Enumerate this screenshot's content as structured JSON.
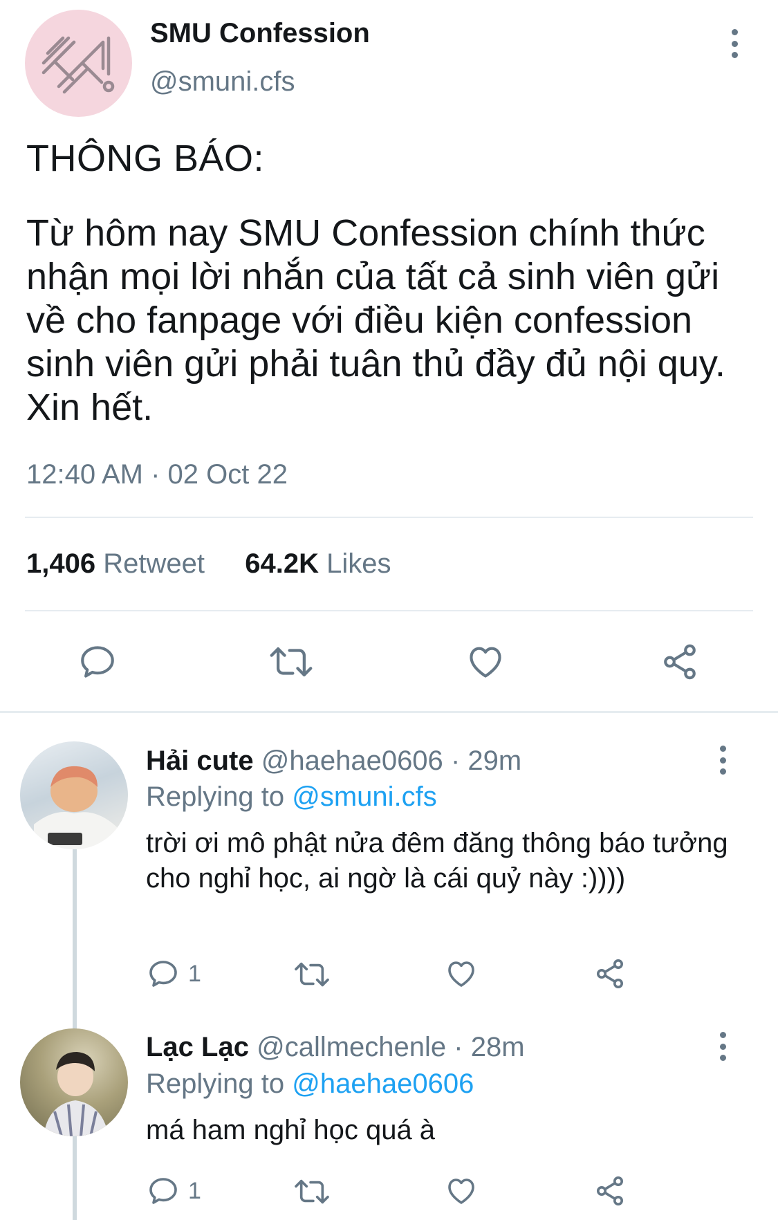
{
  "main_tweet": {
    "name": "SMU Confession",
    "handle": "@smuni.cfs",
    "heading": "THÔNG BÁO:",
    "body": "Từ hôm nay SMU Confession chính thức nhận mọi lời nhắn của tất cả sinh viên gửi về cho fanpage với điều kiện confession sinh viên gửi phải tuân thủ đầy đủ nội quy. Xin hết.",
    "timestamp": "12:40 AM · 02 Oct 22",
    "retweet_count": "1,406",
    "retweet_label": "Retweet",
    "likes_count": "64.2K",
    "likes_label": "Likes"
  },
  "replies": [
    {
      "name": "Hải cute",
      "handle": "@haehae0606",
      "time": "· 29m",
      "replying_prefix": "Replying to",
      "replying_to": "@smuni.cfs",
      "text": "trời ơi mô phật nửa đêm đăng thông báo tưởng cho nghỉ học, ai ngờ là cái quỷ này :))))",
      "reply_count": "1"
    },
    {
      "name": "Lạc Lạc",
      "handle": "@callmechenle",
      "time": "· 28m",
      "replying_prefix": "Replying to",
      "replying_to": "@haehae0606",
      "text": "má ham nghỉ học quá à",
      "reply_count": "1"
    }
  ],
  "icons": [
    "logo-icon",
    "more-icon",
    "reply-icon",
    "retweet-icon",
    "like-icon",
    "share-icon"
  ],
  "colors": {
    "text": "#14171a",
    "secondary": "#657786",
    "link": "#1da1f2",
    "divider": "#e6ecf0",
    "avatar_bg": "#f5d6de"
  }
}
